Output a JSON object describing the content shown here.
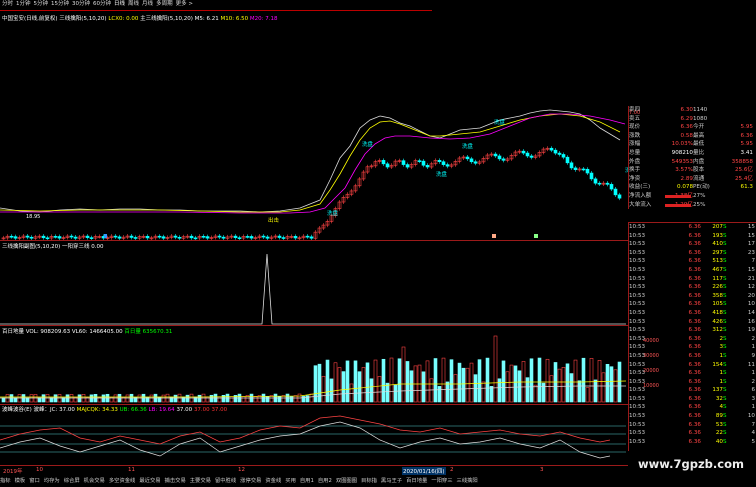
{
  "period_tabs": [
    "分时",
    "1分钟",
    "5分钟",
    "15分钟",
    "30分钟",
    "60分钟",
    "日线",
    "周线",
    "月线",
    "多周期",
    "更多 >"
  ],
  "main_header_1": {
    "name": "中国宝安(日线,前复权)",
    "ind1": "三线擒阳(5,10,20)",
    "ind1_vals": "LCX0: 0.00",
    "ind2": "主三线擒阳(5,10,20)",
    "ma5": "M5: 6.21",
    "m10": "M10: 6.50",
    "m20": "M20: 7.18"
  },
  "annotations": {
    "a1": "洗盘",
    "a2": "洗盘",
    "a3": "洗盘",
    "a4": "洗盘",
    "a5": "洗盘",
    "a6": "洗盘",
    "a7": "出击",
    "price_label": "18.95"
  },
  "y_labels_main": [
    "7.00",
    "7.00",
    "6.00",
    "5.00"
  ],
  "panel2": {
    "title": "三线擒阳副图(5,10,20)",
    "sub": "一阳穿三线 0.00"
  },
  "panel3": {
    "title": "百日地量",
    "vol": "VOL: 908209.63",
    "vol60": "VL60: 1466405.00",
    "baseline": "百日量 635670.31",
    "y": [
      "40000",
      "30000",
      "20000",
      "15000",
      "10000"
    ]
  },
  "panel4": {
    "title": "波峰波谷(E) 波峰：JC: 37.00",
    "maxqk": "MAJCQK: 34.33",
    "ub": "UB: 66.36",
    "lb": "LB: 19.64",
    "v1": "37.00",
    "v2": "37.00",
    "v3": "37.00",
    "y": [
      "100.00",
      "75.00",
      "50.00"
    ]
  },
  "date_axis": {
    "year": "2019年",
    "marks": [
      "10",
      "11",
      "12",
      "2020/01/16(四)",
      "2",
      "3"
    ]
  },
  "quote": {
    "rows": [
      [
        "卖四",
        "6.30",
        "1140"
      ],
      [
        "卖五",
        "6.29",
        "1080"
      ],
      [
        "现价",
        "6.36",
        "今开",
        "5.95"
      ],
      [
        "涨跌",
        "0.58",
        "最高",
        "6.36"
      ],
      [
        "涨幅",
        "10.03%",
        "最低",
        "5.95"
      ],
      [
        "总量",
        "908210",
        "量比",
        "3.41"
      ],
      [
        "外盘",
        "549353",
        "内盘",
        "358858"
      ],
      [
        "换手",
        "3.57%",
        "股本",
        "25.6亿"
      ],
      [
        "净资",
        "2.89",
        "流通",
        "25.4亿"
      ],
      [
        "收益(三)",
        "0.078",
        "PE(动)",
        "61.3"
      ],
      [
        "净流入额",
        "1.38亿",
        "27%"
      ],
      [
        "大单流入",
        "1.29亿",
        "25%"
      ]
    ],
    "ticks": [
      [
        "10:53",
        "6.36",
        "207",
        "S",
        "15"
      ],
      [
        "10:53",
        "6.36",
        "193",
        "S",
        "15"
      ],
      [
        "10:53",
        "6.36",
        "410",
        "S",
        "17"
      ],
      [
        "10:53",
        "6.36",
        "297",
        "S",
        "23"
      ],
      [
        "10:53",
        "6.36",
        "513",
        "S",
        "7"
      ],
      [
        "10:53",
        "6.36",
        "467",
        "S",
        "15"
      ],
      [
        "10:53",
        "6.36",
        "117",
        "S",
        "21"
      ],
      [
        "10:53",
        "6.36",
        "226",
        "S",
        "12"
      ],
      [
        "10:53",
        "6.36",
        "358",
        "S",
        "20"
      ],
      [
        "10:53",
        "6.36",
        "105",
        "S",
        "10"
      ],
      [
        "10:53",
        "6.36",
        "418",
        "S",
        "14"
      ],
      [
        "10:53",
        "6.36",
        "426",
        "S",
        "16"
      ],
      [
        "10:53",
        "6.36",
        "312",
        "S",
        "19"
      ],
      [
        "10:53",
        "6.36",
        "2",
        "S",
        "2"
      ],
      [
        "10:53",
        "6.36",
        "3",
        "S",
        "1"
      ],
      [
        "10:53",
        "6.36",
        "1",
        "S",
        "9"
      ],
      [
        "10:53",
        "6.36",
        "154",
        "S",
        "11"
      ],
      [
        "10:53",
        "6.36",
        "1",
        "S",
        "1"
      ],
      [
        "10:53",
        "6.36",
        "1",
        "S",
        "2"
      ],
      [
        "10:53",
        "6.36",
        "137",
        "S",
        "6"
      ],
      [
        "10:53",
        "6.36",
        "32",
        "S",
        "3"
      ],
      [
        "10:53",
        "6.36",
        "4",
        "S",
        "1"
      ],
      [
        "10:53",
        "6.36",
        "89",
        "S",
        "10"
      ],
      [
        "10:53",
        "6.36",
        "53",
        "S",
        "7"
      ],
      [
        "10:53",
        "6.36",
        "22",
        "S",
        "4"
      ],
      [
        "10:53",
        "6.36",
        "40",
        "S",
        "5"
      ]
    ]
  },
  "bottom_tabs": [
    "指标",
    "模板",
    "窗口",
    "均存为",
    "综合屏",
    "机会交易",
    "多空资金线",
    "最近交易",
    "捕击交易",
    "主要交易",
    "留中胜线",
    "涨停交易",
    "资金线",
    "买用",
    "自用1",
    "自用2",
    "双图图图",
    "目标指",
    "黑马王子",
    "百日地量",
    "一阳穿三",
    "三线擒阳"
  ],
  "watermark": "www.7gpzb.com"
}
